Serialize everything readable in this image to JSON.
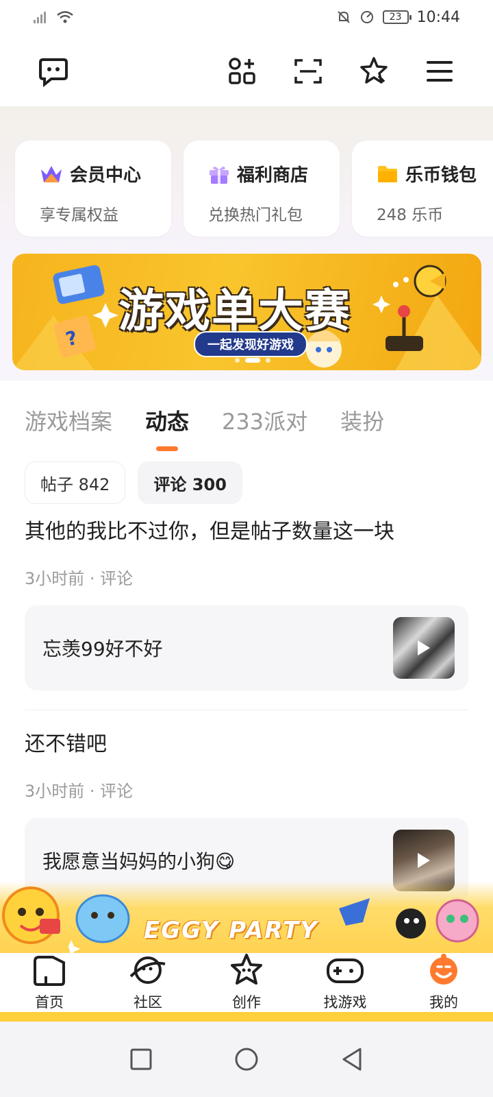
{
  "status_bar": {
    "time": "10:44",
    "battery": "23"
  },
  "header": {
    "icons": [
      "chat-bubble-icon",
      "apps-grid-icon",
      "scan-icon",
      "star-badge-icon",
      "menu-icon"
    ]
  },
  "quick_cards": [
    {
      "title": "会员中心",
      "subtitle": "享专属权益",
      "icon": "crown-icon"
    },
    {
      "title": "福利商店",
      "subtitle": "兑换热门礼包",
      "icon": "gift-icon"
    },
    {
      "title": "乐币钱包",
      "subtitle": "248 乐币",
      "icon": "wallet-icon"
    }
  ],
  "banner": {
    "title": "游戏单大赛",
    "subtitle": "一起发现好游戏"
  },
  "tabs": [
    "游戏档案",
    "动态",
    "233派对",
    "装扮"
  ],
  "active_tab": "动态",
  "chips": [
    {
      "label": "帖子 842"
    },
    {
      "label": "评论 300"
    }
  ],
  "posts": [
    {
      "text": "其他的我比不过你，但是帖子数量这一块",
      "meta": "3小时前 · 评论",
      "quote": "忘羡99好不好"
    },
    {
      "text": "还不错吧",
      "meta": "3小时前 · 评论",
      "quote": "我愿意当妈妈的小狗😋"
    }
  ],
  "promo": {
    "title": "EGGY PARTY"
  },
  "bottom_nav": [
    {
      "label": "首页",
      "icon": "home-icon"
    },
    {
      "label": "社区",
      "icon": "planet-icon"
    },
    {
      "label": "创作",
      "icon": "star-create-icon"
    },
    {
      "label": "找游戏",
      "icon": "gamepad-icon"
    },
    {
      "label": "我的",
      "icon": "profile-face-icon"
    }
  ],
  "colors": {
    "accent": "#ff7a2e",
    "banner_yellow": "#f9c52d",
    "nav_stripe": "#ffcf3c"
  }
}
